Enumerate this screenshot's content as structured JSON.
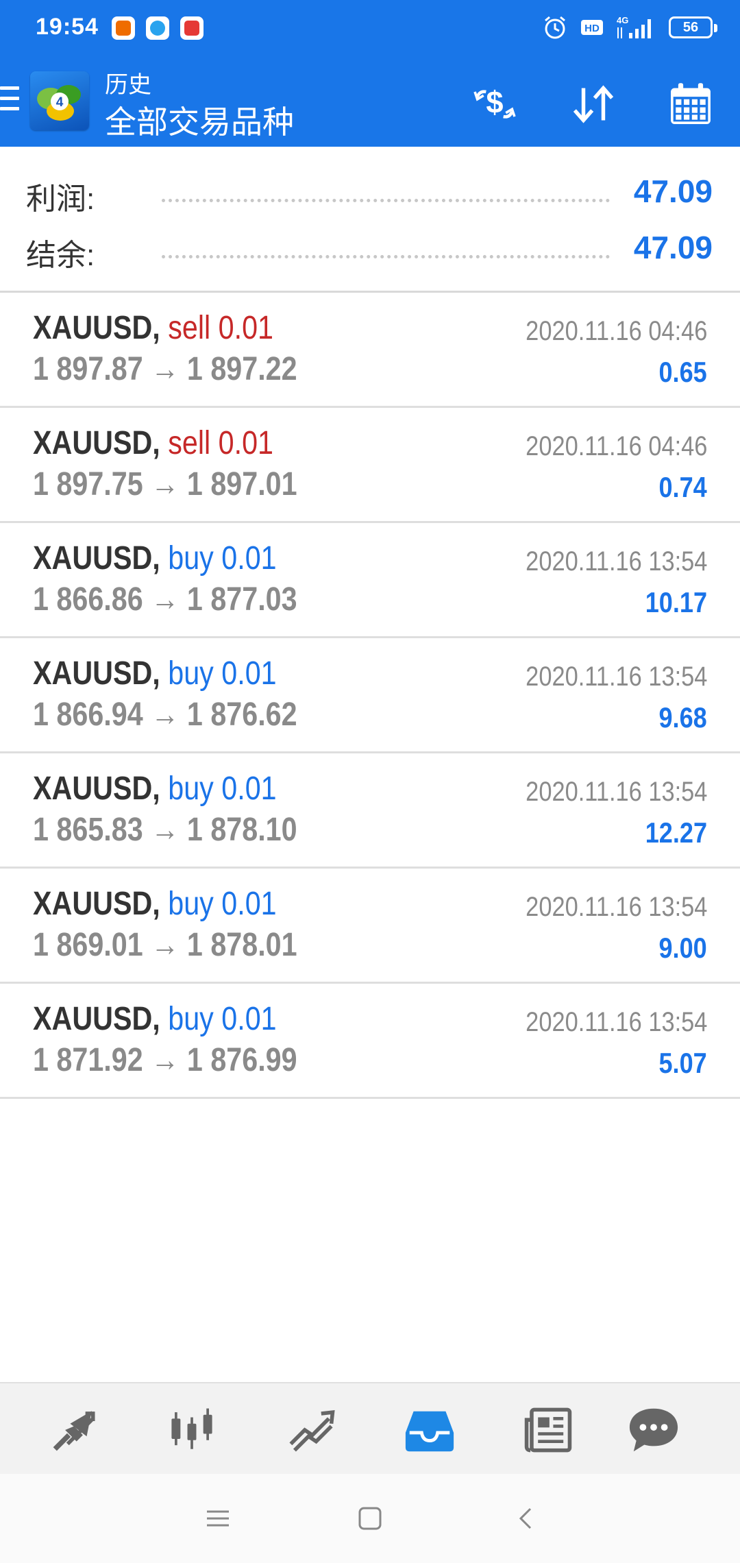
{
  "status_bar": {
    "time": "19:54",
    "apps": [
      "orange-app-icon",
      "blue-app-icon",
      "sogou-app-icon"
    ],
    "right_icons": [
      "alarm-icon",
      "hd-icon",
      "4g-signal-icon"
    ],
    "battery": "56"
  },
  "app_bar": {
    "menu_icon": "hamburger-icon",
    "logo": "metatrader-4-logo",
    "title_small": "历史",
    "title_big": "全部交易品种",
    "actions": [
      "currency-icon",
      "sort-icon",
      "calendar-icon"
    ]
  },
  "summary": {
    "profit_label": "利润:",
    "profit_value": "47.09",
    "balance_label": "结余:",
    "balance_value": "47.09"
  },
  "trades": [
    {
      "symbol": "XAUUSD,",
      "side": "sell",
      "volume_text": "sell 0.01",
      "open": "1 897.87",
      "arrow": "→",
      "close": "1 897.22",
      "time": "2020.11.16 04:46",
      "profit": "0.65"
    },
    {
      "symbol": "XAUUSD,",
      "side": "sell",
      "volume_text": "sell 0.01",
      "open": "1 897.75",
      "arrow": "→",
      "close": "1 897.01",
      "time": "2020.11.16 04:46",
      "profit": "0.74"
    },
    {
      "symbol": "XAUUSD,",
      "side": "buy",
      "volume_text": "buy 0.01",
      "open": "1 866.86",
      "arrow": "→",
      "close": "1 877.03",
      "time": "2020.11.16 13:54",
      "profit": "10.17"
    },
    {
      "symbol": "XAUUSD,",
      "side": "buy",
      "volume_text": "buy 0.01",
      "open": "1 866.94",
      "arrow": "→",
      "close": "1 876.62",
      "time": "2020.11.16 13:54",
      "profit": "9.68"
    },
    {
      "symbol": "XAUUSD,",
      "side": "buy",
      "volume_text": "buy 0.01",
      "open": "1 865.83",
      "arrow": "→",
      "close": "1 878.10",
      "time": "2020.11.16 13:54",
      "profit": "12.27"
    },
    {
      "symbol": "XAUUSD,",
      "side": "buy",
      "volume_text": "buy 0.01",
      "open": "1 869.01",
      "arrow": "→",
      "close": "1 878.01",
      "time": "2020.11.16 13:54",
      "profit": "9.00"
    },
    {
      "symbol": "XAUUSD,",
      "side": "buy",
      "volume_text": "buy 0.01",
      "open": "1 871.92",
      "arrow": "→",
      "close": "1 876.99",
      "time": "2020.11.16 13:54",
      "profit": "5.07"
    }
  ],
  "bottom_nav": {
    "items": [
      "quotes-icon",
      "chart-icon",
      "trade-icon",
      "history-icon",
      "news-icon",
      "chat-icon"
    ],
    "active": "history-icon"
  },
  "system_nav": [
    "recents-icon",
    "home-icon",
    "back-icon"
  ],
  "colors": {
    "primary": "#1976e8",
    "sell": "#c62828",
    "buy": "#1a73e8",
    "muted": "#8a8a8a"
  }
}
